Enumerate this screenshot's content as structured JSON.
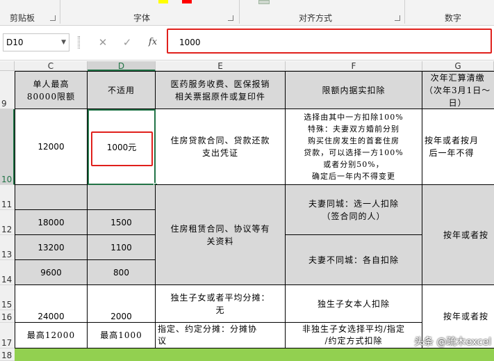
{
  "ribbon": {
    "groups": [
      "剪贴板",
      "字体",
      "对齐方式",
      "数字"
    ]
  },
  "formula_bar": {
    "name_box": "D10",
    "cancel_icon": "✕",
    "enter_icon": "✓",
    "fx_label": "fx",
    "content": "1000"
  },
  "columns": [
    "C",
    "D",
    "E",
    "F",
    "G"
  ],
  "rows": [
    "9",
    "10",
    "11",
    "12",
    "13",
    "14",
    "15",
    "16",
    "17",
    "18"
  ],
  "cells": {
    "c9": "单人最高\n80000限额",
    "d9": "不适用",
    "e9": "医药服务收费、医保报销\n相关票据原件或复印件",
    "f9": "限额内据实扣除",
    "g9": "次年汇算清缴\n（次年3月1日～\n日）",
    "c10": "12000",
    "d10": "1000元",
    "e10": "住房贷款合同、贷款还款\n支出凭证",
    "f10": "选择由其中一方扣除100%\n特殊：夫妻双方婚前分别\n购买住房发生的首套住房\n贷款，可以选择一方100%\n或者分别50%，\n确定后一年内不得变更",
    "g10": "按年或者按月\n后一年不得",
    "c11": "",
    "d11": "",
    "c12": "18000",
    "d12": "1500",
    "c13": "13200",
    "d13": "1100",
    "c14": "9600",
    "d14": "800",
    "e11": "住房租赁合同、协议等有\n关资料",
    "f11": "夫妻同城：选一人扣除\n（签合同的人）",
    "f13": "夫妻不同城：各自扣除",
    "g11": "按年或者按",
    "c15": "",
    "d15": "",
    "e15": "独生子女或者平均分摊：\n无",
    "f15": "独生子女本人扣除",
    "c16": "24000",
    "d16": "2000",
    "g15": "按年或者按",
    "c17": "最高12000",
    "d17": "最高1000",
    "e17": "指定、约定分摊：分摊协\n议",
    "f17": "非独生子女选择平均/指定\n/约定方式扣除"
  },
  "watermark": "头条 @疏木excel",
  "colors": {
    "highlight_red": "#e0201c",
    "gray_fill": "#d9d9d9",
    "green_fill": "#92d050"
  }
}
